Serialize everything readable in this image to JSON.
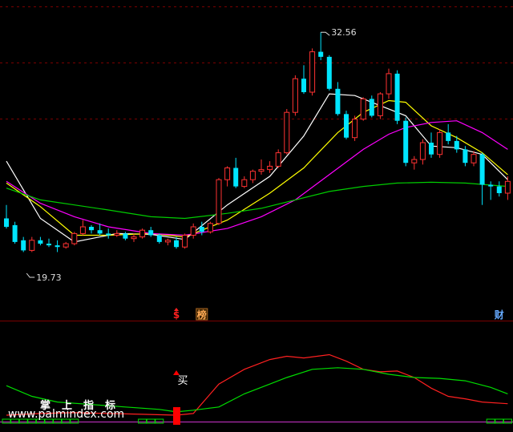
{
  "chart_data": [
    {
      "type": "candlestick",
      "panel": "price",
      "labels": {
        "high": "32.56",
        "low": "19.73"
      },
      "colors": {
        "up": "#ff3232",
        "down": "#00e5ff",
        "ma5": "#ffffff",
        "ma10": "#ffff00",
        "ma20": "#ff00ff",
        "ma60": "#00cc00",
        "grid": "#7a0000"
      },
      "ylim": [
        18,
        34
      ],
      "grid": true,
      "candles": [
        [
          21.5,
          22.3,
          20.9,
          21.0
        ],
        [
          21.1,
          21.3,
          20.0,
          20.1
        ],
        [
          20.2,
          20.4,
          19.5,
          19.6
        ],
        [
          19.6,
          20.4,
          19.5,
          20.2
        ],
        [
          20.2,
          20.4,
          19.9,
          20.0
        ],
        [
          20.0,
          20.3,
          19.8,
          19.9
        ],
        [
          19.9,
          20.2,
          19.5,
          19.8
        ],
        [
          19.8,
          20.1,
          19.7,
          20.0
        ],
        [
          20.0,
          20.7,
          19.9,
          20.6
        ],
        [
          20.6,
          21.4,
          20.5,
          21.0
        ],
        [
          21.0,
          21.1,
          20.6,
          20.8
        ],
        [
          20.8,
          21.2,
          20.5,
          20.6
        ],
        [
          20.6,
          20.9,
          20.3,
          20.5
        ],
        [
          20.5,
          20.8,
          20.4,
          20.6
        ],
        [
          20.6,
          20.7,
          20.2,
          20.3
        ],
        [
          20.3,
          20.6,
          20.1,
          20.4
        ],
        [
          20.4,
          20.9,
          20.3,
          20.8
        ],
        [
          20.8,
          21.0,
          20.4,
          20.5
        ],
        [
          20.5,
          20.6,
          20.0,
          20.1
        ],
        [
          20.1,
          20.3,
          19.9,
          20.2
        ],
        [
          20.2,
          20.4,
          19.7,
          19.8
        ],
        [
          19.8,
          20.6,
          19.7,
          20.5
        ],
        [
          20.5,
          21.2,
          20.3,
          21.0
        ],
        [
          21.0,
          21.3,
          20.5,
          20.7
        ],
        [
          20.7,
          21.3,
          20.6,
          21.2
        ],
        [
          21.2,
          23.9,
          21.1,
          23.8
        ],
        [
          23.8,
          24.6,
          23.4,
          24.5
        ],
        [
          24.5,
          25.1,
          23.3,
          23.4
        ],
        [
          23.4,
          24.0,
          23.3,
          23.8
        ],
        [
          23.8,
          24.4,
          23.6,
          24.3
        ],
        [
          24.3,
          25.0,
          24.1,
          24.4
        ],
        [
          24.4,
          24.9,
          24.2,
          24.6
        ],
        [
          24.6,
          25.6,
          24.5,
          25.4
        ],
        [
          25.4,
          28.0,
          25.3,
          27.8
        ],
        [
          27.8,
          30.0,
          27.6,
          29.8
        ],
        [
          29.8,
          30.6,
          28.9,
          29.0
        ],
        [
          29.0,
          31.6,
          28.8,
          31.4
        ],
        [
          31.4,
          32.56,
          30.9,
          31.1
        ],
        [
          31.1,
          31.2,
          29.1,
          29.2
        ],
        [
          29.2,
          29.6,
          27.6,
          27.7
        ],
        [
          27.7,
          27.9,
          26.2,
          26.3
        ],
        [
          26.3,
          27.6,
          26.1,
          27.4
        ],
        [
          27.4,
          28.7,
          27.3,
          28.6
        ],
        [
          28.6,
          28.8,
          27.5,
          27.6
        ],
        [
          27.6,
          29.0,
          27.4,
          28.9
        ],
        [
          28.9,
          30.4,
          28.6,
          30.1
        ],
        [
          30.1,
          30.3,
          27.1,
          27.3
        ],
        [
          27.3,
          27.5,
          24.6,
          24.8
        ],
        [
          24.8,
          25.2,
          24.4,
          25.0
        ],
        [
          25.0,
          26.2,
          24.7,
          26.0
        ],
        [
          26.0,
          26.6,
          25.1,
          25.3
        ],
        [
          25.3,
          26.8,
          25.1,
          26.6
        ],
        [
          26.6,
          27.1,
          25.9,
          26.1
        ],
        [
          26.1,
          26.4,
          25.4,
          25.6
        ],
        [
          25.6,
          25.8,
          24.6,
          24.8
        ],
        [
          24.8,
          25.5,
          24.6,
          25.3
        ],
        [
          25.3,
          25.4,
          22.3,
          23.5
        ],
        [
          23.5,
          23.7,
          22.6,
          23.4
        ],
        [
          23.4,
          23.7,
          22.8,
          23.0
        ],
        [
          23.0,
          24.0,
          22.6,
          23.7
        ]
      ],
      "ma": {
        "ma5": [
          [
            0,
            24.9
          ],
          [
            4,
            21.5
          ],
          [
            8,
            20.1
          ],
          [
            13,
            20.6
          ],
          [
            17,
            20.55
          ],
          [
            21,
            20.25
          ],
          [
            26,
            22.3
          ],
          [
            31,
            24.0
          ],
          [
            35,
            26.4
          ],
          [
            38,
            28.9
          ],
          [
            41,
            28.8
          ],
          [
            44,
            28.2
          ],
          [
            47,
            27.6
          ],
          [
            50,
            25.8
          ],
          [
            53,
            25.7
          ],
          [
            56,
            25.3
          ],
          [
            59,
            23.8
          ]
        ],
        "ma10": [
          [
            0,
            23.6
          ],
          [
            4,
            22.2
          ],
          [
            8,
            20.5
          ],
          [
            12,
            20.5
          ],
          [
            17,
            20.6
          ],
          [
            21,
            20.4
          ],
          [
            26,
            21.4
          ],
          [
            31,
            23.0
          ],
          [
            35,
            24.5
          ],
          [
            39,
            26.6
          ],
          [
            42,
            27.8
          ],
          [
            45,
            28.5
          ],
          [
            47,
            28.4
          ],
          [
            50,
            27.0
          ],
          [
            53,
            26.3
          ],
          [
            56,
            25.4
          ],
          [
            59,
            24.1
          ]
        ],
        "ma20": [
          [
            0,
            23.7
          ],
          [
            4,
            22.4
          ],
          [
            8,
            21.6
          ],
          [
            12,
            21.0
          ],
          [
            17,
            20.6
          ],
          [
            21,
            20.5
          ],
          [
            26,
            20.9
          ],
          [
            30,
            21.6
          ],
          [
            34,
            22.6
          ],
          [
            38,
            24.1
          ],
          [
            42,
            25.6
          ],
          [
            45,
            26.5
          ],
          [
            47,
            26.9
          ],
          [
            50,
            27.2
          ],
          [
            53,
            27.3
          ],
          [
            56,
            26.6
          ],
          [
            59,
            25.6
          ]
        ],
        "ma60": [
          [
            0,
            23.3
          ],
          [
            4,
            22.6
          ],
          [
            8,
            22.3
          ],
          [
            12,
            22.0
          ],
          [
            17,
            21.6
          ],
          [
            21,
            21.5
          ],
          [
            26,
            21.8
          ],
          [
            30,
            22.1
          ],
          [
            34,
            22.6
          ],
          [
            38,
            23.1
          ],
          [
            42,
            23.4
          ],
          [
            46,
            23.6
          ],
          [
            50,
            23.65
          ],
          [
            54,
            23.6
          ],
          [
            59,
            23.4
          ]
        ]
      },
      "markers": [
        {
          "index": 20,
          "text": "$",
          "color": "#ff2020",
          "arrow": true
        },
        {
          "index": 23,
          "text": "榜",
          "color": "#ffaa55",
          "boxed": true
        },
        {
          "index": 58,
          "text": "财",
          "color": "#66aaff"
        }
      ]
    },
    {
      "type": "line",
      "panel": "indicator",
      "ylim": [
        0,
        100
      ],
      "colors": {
        "red": "#ff2020",
        "green": "#00dd00",
        "magenta": "#cc33cc",
        "box": "#00dd00",
        "signal": "#ff0000"
      },
      "series": [
        {
          "color": "#ff2020",
          "values": [
            [
              0,
              2
            ],
            [
              4,
              4
            ],
            [
              8,
              5
            ],
            [
              12,
              4
            ],
            [
              16,
              3
            ],
            [
              20,
              2
            ],
            [
              22,
              4
            ],
            [
              25,
              40
            ],
            [
              28,
              58
            ],
            [
              31,
              70
            ],
            [
              33,
              74
            ],
            [
              35,
              72
            ],
            [
              38,
              76
            ],
            [
              40,
              68
            ],
            [
              42,
              58
            ],
            [
              44,
              55
            ],
            [
              46,
              56
            ],
            [
              48,
              48
            ],
            [
              50,
              35
            ],
            [
              52,
              25
            ],
            [
              54,
              22
            ],
            [
              56,
              18
            ],
            [
              59,
              16
            ]
          ]
        },
        {
          "color": "#00dd00",
          "values": [
            [
              0,
              38
            ],
            [
              3,
              25
            ],
            [
              6,
              18
            ],
            [
              10,
              15
            ],
            [
              14,
              12
            ],
            [
              18,
              9
            ],
            [
              20,
              6
            ],
            [
              22,
              8
            ],
            [
              25,
              12
            ],
            [
              28,
              28
            ],
            [
              31,
              40
            ],
            [
              33,
              48
            ],
            [
              36,
              58
            ],
            [
              39,
              60
            ],
            [
              42,
              58
            ],
            [
              45,
              52
            ],
            [
              48,
              48
            ],
            [
              51,
              47
            ],
            [
              54,
              44
            ],
            [
              57,
              36
            ],
            [
              59,
              28
            ]
          ]
        }
      ],
      "signal": {
        "index": 20,
        "text": "买"
      },
      "box_runs": [
        [
          0,
          8
        ],
        [
          16,
          18
        ],
        [
          57,
          59
        ]
      ]
    }
  ],
  "watermark": {
    "title": "掌上指标",
    "url": "www.palmindex.com"
  }
}
